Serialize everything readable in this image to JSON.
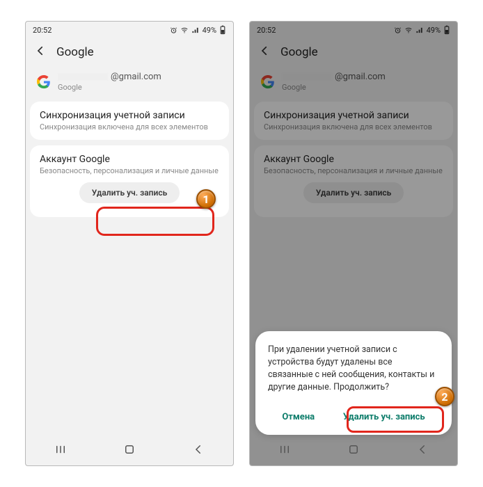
{
  "status": {
    "time": "20:52",
    "battery_text": "49%"
  },
  "header": {
    "title": "Google"
  },
  "account": {
    "email_suffix": "@gmail.com",
    "provider": "Google"
  },
  "sync": {
    "title": "Синхронизация учетной записи",
    "subtitle": "Синхронизация включена для всех элементов"
  },
  "google_acct": {
    "title": "Аккаунт Google",
    "subtitle": "Безопасность, персонализация и личные данные"
  },
  "delete_btn": "Удалить уч. запись",
  "dialog": {
    "text": "При удалении учетной записи с устройства будут удалены все связанные с ней сообщения, контакты и другие данные. Продолжить?",
    "cancel": "Отмена",
    "confirm": "Удалить уч. запись"
  },
  "badges": {
    "one": "1",
    "two": "2"
  }
}
